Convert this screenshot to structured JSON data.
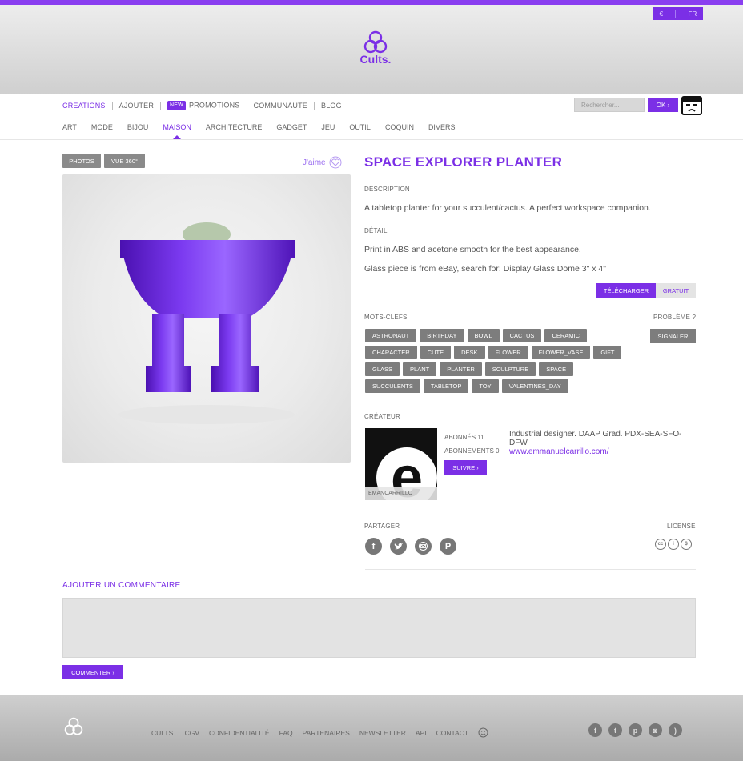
{
  "header": {
    "currency": "€",
    "language": "FR",
    "logo_text": "Cults."
  },
  "main_nav": {
    "items": [
      {
        "label": "CRÉATIONS",
        "active": true
      },
      {
        "label": "AJOUTER"
      },
      {
        "label": "PROMOTIONS",
        "badge": "NEW"
      },
      {
        "label": "COMMUNAUTÉ"
      },
      {
        "label": "BLOG"
      }
    ],
    "search_placeholder": "Rechercher...",
    "ok_label": "OK ›"
  },
  "sub_nav": {
    "items": [
      "ART",
      "MODE",
      "BIJOU",
      "MAISON",
      "ARCHITECTURE",
      "GADGET",
      "JEU",
      "OUTIL",
      "COQUIN",
      "DIVERS"
    ],
    "active": "MAISON"
  },
  "gallery": {
    "photos_label": "PHOTOS",
    "view360_label": "VUE 360°",
    "like_label": "J'aime"
  },
  "product": {
    "title": "SPACE EXPLORER PLANTER",
    "description_label": "DESCRIPTION",
    "description": "A tabletop planter for your succulent/cactus. A perfect workspace companion.",
    "detail_label": "DÉTAIL",
    "detail_1": "Print in ABS and acetone smooth for the best appearance.",
    "detail_2": "Glass piece is from eBay, search for: Display Glass Dome 3\" x 4\"",
    "download_label": "TÉLÉCHARGER",
    "price_label": "GRATUIT"
  },
  "keywords": {
    "label": "MOTS-CLEFS",
    "problem_label": "PROBLÈME ?",
    "report_label": "SIGNALER",
    "tags": [
      "ASTRONAUT",
      "BIRTHDAY",
      "BOWL",
      "CACTUS",
      "CERAMIC",
      "CHARACTER",
      "CUTE",
      "DESK",
      "FLOWER",
      "FLOWER_VASE",
      "GIFT",
      "GLASS",
      "PLANT",
      "PLANTER",
      "SCULPTURE",
      "SPACE",
      "SUCCULENTS",
      "TABLETOP",
      "TOY",
      "VALENTINES_DAY"
    ]
  },
  "creator": {
    "label": "CRÉATEUR",
    "username": "EMANCARRILLO",
    "avatar_letter": "e",
    "followers": "ABONNÉS 11",
    "following": "ABONNEMENTS 0",
    "follow_label": "SUIVRE ›",
    "bio": "Industrial designer. DAAP Grad. PDX-SEA-SFO-DFW",
    "website": "www.emmanuelcarrillo.com/"
  },
  "share": {
    "label": "PARTAGER",
    "license_label": "LICENSE",
    "icons": [
      "facebook-icon",
      "twitter-icon",
      "email-icon",
      "pinterest-icon"
    ]
  },
  "comment": {
    "title": "AJOUTER UN COMMENTAIRE",
    "submit_label": "COMMENTER ›"
  },
  "footer": {
    "links": [
      "CULTS.",
      "CGV",
      "CONFIDENTIALITÉ",
      "FAQ",
      "PARTENAIRES",
      "NEWSLETTER",
      "API",
      "CONTACT"
    ],
    "social": [
      "facebook-icon",
      "twitter-icon",
      "pinterest-icon",
      "instagram-icon",
      "rss-icon"
    ]
  },
  "colors": {
    "accent": "#7b2fe6",
    "tag_bg": "#7d7d7d"
  }
}
